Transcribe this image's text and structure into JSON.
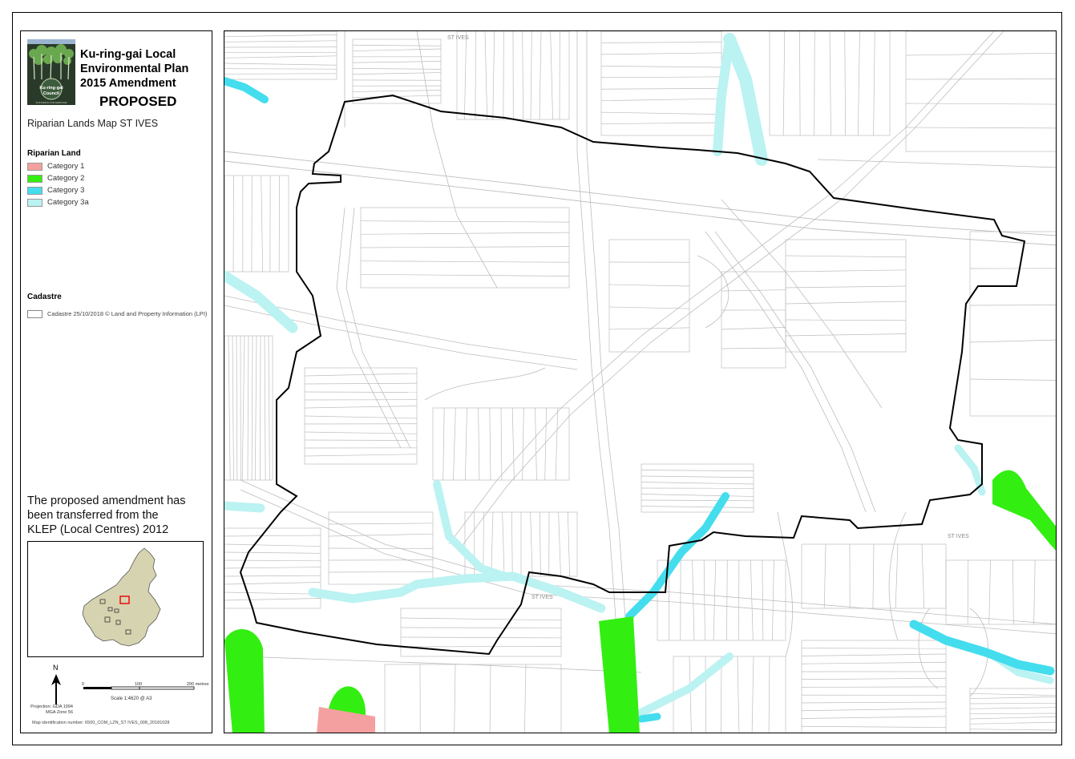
{
  "council": {
    "name_line1": "Ku-ring-gai",
    "name_line2": "Council",
    "tagline": "SUSTAINING OUR HERITAGE"
  },
  "title": {
    "line1": "Ku-ring-gai Local",
    "line2": "Environmental Plan",
    "line3": "2015 Amendment",
    "status": "PROPOSED"
  },
  "map_name": "Riparian Lands Map ST IVES",
  "legend": {
    "riparian_heading": "Riparian Land",
    "categories": [
      {
        "label": "Category 1",
        "color": "#f4a0a0"
      },
      {
        "label": "Category 2",
        "color": "#33ee11"
      },
      {
        "label": "Category 3",
        "color": "#44ddee"
      },
      {
        "label": "Category 3a",
        "color": "#bbf2f2"
      }
    ],
    "cadastre_heading": "Cadastre",
    "cadastre_label": "Cadastre 25/10/2018 © Land and Property Information (LPI)"
  },
  "note": {
    "line1": "The proposed amendment has",
    "line2": "been transferred from the",
    "line3": "KLEP (Local Centres) 2012"
  },
  "north_label": "N",
  "projection": {
    "line1": "Projection: GDA 1994",
    "line2": "MGA Zone 56"
  },
  "scale": {
    "tick0": "0",
    "tick1": "100",
    "tick2": "200 metres",
    "text": "Scale    1:4620   @ A3"
  },
  "map_id": "Map identification number:  6500_COM_LZN_ST IVES_008_20181028",
  "map_labels": {
    "st_ives_top": "ST IVES",
    "st_ives_mid": "ST IVES",
    "st_ives_right": "ST IVES"
  },
  "colors": {
    "boundary": "#000000",
    "cadastre": "#bdbdbd",
    "inset_fill": "#d6d3b0"
  }
}
